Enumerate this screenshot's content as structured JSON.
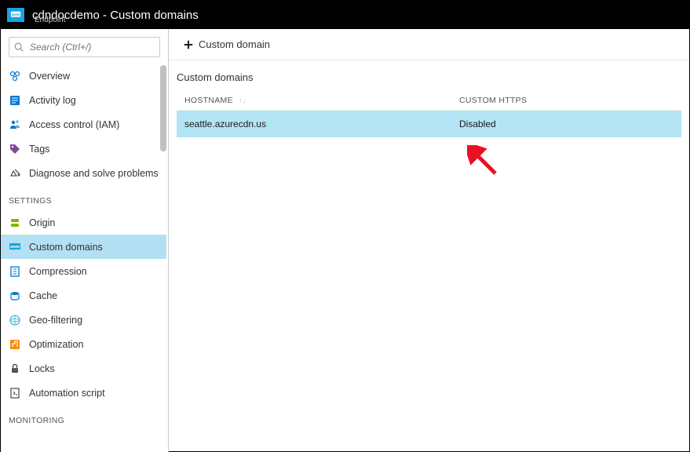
{
  "header": {
    "title": "cdndocdemo - Custom domains",
    "subtitle": "Endpoint"
  },
  "sidebar": {
    "search_placeholder": "Search (Ctrl+/)",
    "top": [
      {
        "label": "Overview",
        "icon": "overview"
      },
      {
        "label": "Activity log",
        "icon": "activitylog"
      },
      {
        "label": "Access control (IAM)",
        "icon": "access"
      },
      {
        "label": "Tags",
        "icon": "tags"
      },
      {
        "label": "Diagnose and solve problems",
        "icon": "diagnose"
      }
    ],
    "settings_label": "SETTINGS",
    "settings": [
      {
        "label": "Origin",
        "icon": "origin"
      },
      {
        "label": "Custom domains",
        "icon": "customdomains",
        "active": true
      },
      {
        "label": "Compression",
        "icon": "compression"
      },
      {
        "label": "Cache",
        "icon": "cache"
      },
      {
        "label": "Geo-filtering",
        "icon": "geo"
      },
      {
        "label": "Optimization",
        "icon": "optimization"
      },
      {
        "label": "Locks",
        "icon": "locks"
      },
      {
        "label": "Automation script",
        "icon": "automation"
      }
    ],
    "monitoring_label": "MONITORING"
  },
  "commandbar": {
    "add_domain": "Custom domain"
  },
  "content": {
    "title": "Custom domains",
    "columns": {
      "hostname": "HOSTNAME",
      "https": "CUSTOM HTTPS"
    },
    "rows": [
      {
        "hostname": "seattle.azurecdn.us",
        "https": "Disabled"
      }
    ]
  }
}
